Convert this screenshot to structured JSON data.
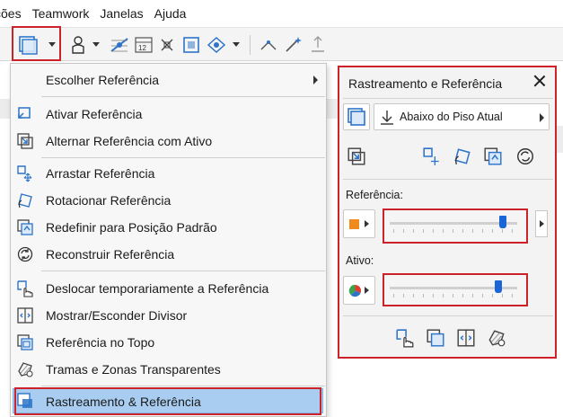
{
  "menubar": {
    "items": [
      "ções",
      "Teamwork",
      "Janelas",
      "Ajuda"
    ]
  },
  "menu": {
    "items": [
      {
        "label": "Escolher Referência",
        "icon": "none",
        "submenu": true
      },
      {
        "label": "Ativar Referência",
        "icon": "activate-reference-icon"
      },
      {
        "label": "Alternar Referência com Ativo",
        "icon": "swap-reference-icon"
      },
      {
        "label": "Arrastar Referência",
        "icon": "drag-reference-icon"
      },
      {
        "label": "Rotacionar Referência",
        "icon": "rotate-reference-icon"
      },
      {
        "label": "Redefinir para Posição Padrão",
        "icon": "reset-position-icon"
      },
      {
        "label": "Reconstruir Referência",
        "icon": "rebuild-reference-icon"
      },
      {
        "label": "Deslocar temporariamente a Referência",
        "icon": "temporary-shift-icon"
      },
      {
        "label": "Mostrar/Esconder Divisor",
        "icon": "divider-icon"
      },
      {
        "label": "Referência no Topo",
        "icon": "reference-on-top-icon"
      },
      {
        "label": "Tramas e Zonas Transparentes",
        "icon": "transparent-fills-icon"
      },
      {
        "label": "Rastreamento & Referência",
        "icon": "trace-reference-icon",
        "selected": true
      }
    ]
  },
  "palette": {
    "title": "Rastreamento e Referência",
    "reference_dropdown": "Abaixo do Piso Atual",
    "reference_label": "Referência:",
    "active_label": "Ativo:",
    "reference_slider_value": 0.91,
    "active_slider_value": 0.87
  },
  "colors": {
    "highlight_border": "#cc2229",
    "selected_item_bg": "#a9cdf0",
    "slider_thumb": "#1a66d6",
    "icon_blue": "#2d74c9",
    "reference_swatch": "#f08a1c"
  }
}
